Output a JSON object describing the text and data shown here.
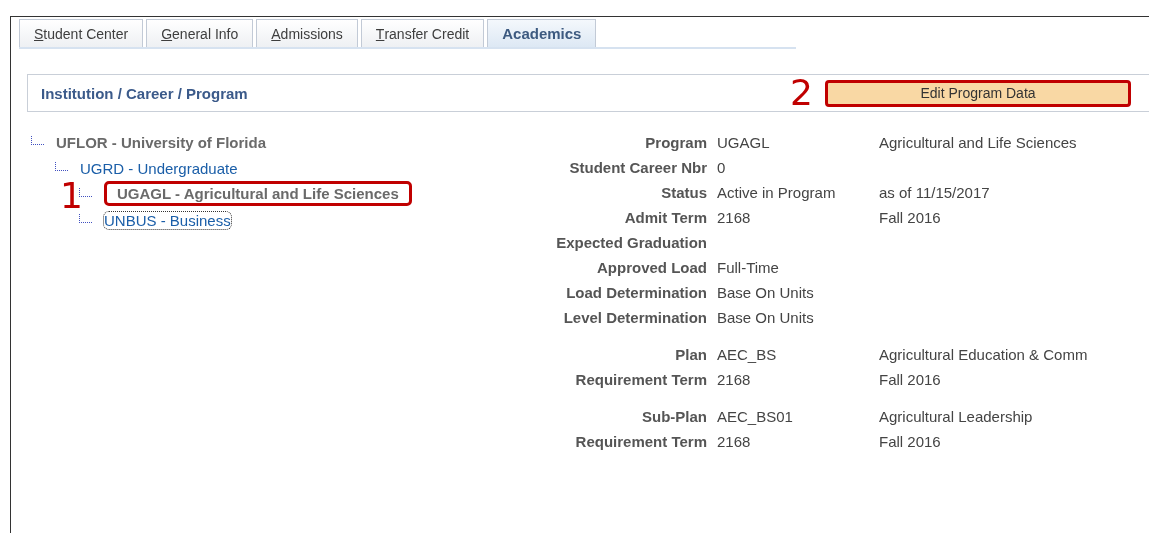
{
  "tabs": [
    {
      "label": "Student Center",
      "underline_first": true,
      "selected": false
    },
    {
      "label": "General Info",
      "underline_first": true,
      "selected": false
    },
    {
      "label": "Admissions",
      "underline_first": true,
      "selected": false
    },
    {
      "label": "Transfer Credit",
      "underline_first": true,
      "selected": false
    },
    {
      "label": "Academics",
      "underline_first": false,
      "selected": true
    }
  ],
  "section": {
    "title": "Institution / Career / Program",
    "button": {
      "label": "Edit Program Data",
      "annotation": "2"
    }
  },
  "tree": [
    {
      "label": "UFLOR - University of Florida",
      "link": false,
      "focused": false,
      "children": [
        {
          "label": "UGRD - Undergraduate",
          "link": true,
          "focused": false,
          "children": [
            {
              "label": "UGAGL - Agricultural and Life Sciences",
              "link": false,
              "focused": false,
              "annotation": "1"
            },
            {
              "label": "UNBUS - Business",
              "link": true,
              "focused": true
            }
          ]
        }
      ]
    }
  ],
  "details": [
    {
      "rows": [
        {
          "label": "Program",
          "value": "UGAGL",
          "description": "Agricultural and Life Sciences"
        },
        {
          "label": "Student Career Nbr",
          "value": "0"
        },
        {
          "label": "Status",
          "value": "Active in Program",
          "description": "as of 11/15/2017"
        },
        {
          "label": "Admit Term",
          "value": "2168",
          "description": "Fall 2016"
        },
        {
          "label": "Expected Graduation"
        },
        {
          "label": "Approved Load",
          "value": "Full-Time"
        },
        {
          "label": "Load Determination",
          "value": "Base On Units"
        },
        {
          "label": "Level Determination",
          "value": "Base On Units"
        }
      ]
    },
    {
      "rows": [
        {
          "label": "Plan",
          "value": "AEC_BS",
          "description": "Agricultural Education & Comm"
        },
        {
          "label": "Requirement Term",
          "value": "2168",
          "description": "Fall 2016"
        }
      ]
    },
    {
      "rows": [
        {
          "label": "Sub-Plan",
          "value": "AEC_BS01",
          "description": "Agricultural Leadership"
        },
        {
          "label": "Requirement Term",
          "value": "2168",
          "description": "Fall 2016"
        }
      ]
    }
  ]
}
